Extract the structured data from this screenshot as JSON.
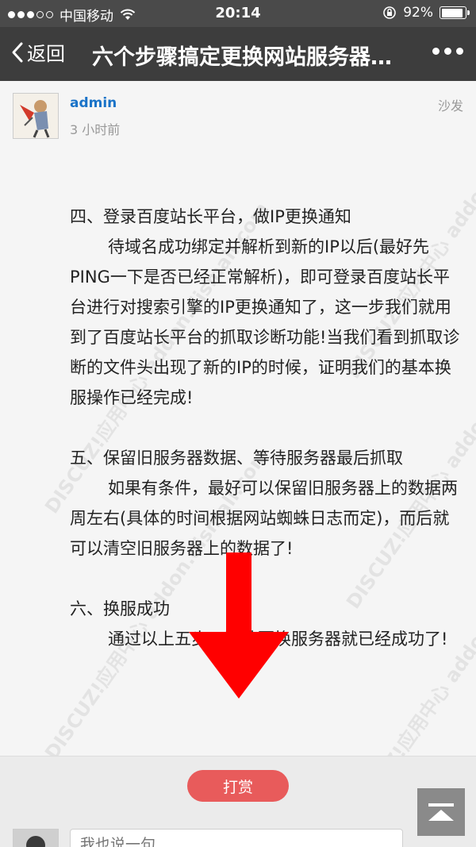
{
  "status_bar": {
    "carrier": "中国移动",
    "time": "20:14",
    "battery": "92%",
    "battery_level": 0.92
  },
  "nav": {
    "back_label": "返回",
    "title": "六个步骤搞定更换网站服务器…"
  },
  "post": {
    "author": "admin",
    "time": "3 小时前",
    "floor": "沙发",
    "watermark": "DISCUZ!应用中心 addon.dismall.com",
    "paragraphs": [
      {
        "text": "四、登录百度站长平台，做IP更换通知",
        "indent": false
      },
      {
        "text": "待域名成功绑定并解析到新的IP以后(最好先PING一下是否已经正常解析)，即可登录百度站长平台进行对搜索引擎的IP更换通知了，这一步我们就用到了百度站长平台的抓取诊断功能!当我们看到抓取诊断的文件头出现了新的IP的时候，证明我们的基本换服操作已经完成!",
        "indent": true
      },
      {
        "text": "",
        "gap": true
      },
      {
        "text": "五、保留旧服务器数据、等待服务器最后抓取",
        "indent": false
      },
      {
        "text": "如果有条件，最好可以保留旧服务器上的数据两周左右(具体的时间根据网站蜘蛛日志而定)，而后就可以清空旧服务器上的数据了!",
        "indent": true
      },
      {
        "text": "",
        "gap": true
      },
      {
        "text": "六、换服成功",
        "indent": false
      },
      {
        "text": "通过以上五步，网站更换服务器就已经成功了!",
        "indent": true
      }
    ]
  },
  "reward_button": "打赏",
  "comment": {
    "placeholder": "我也说一句"
  },
  "colors": {
    "nav_bg": "#3d3d3d",
    "status_bg": "#4a4a4a",
    "author": "#1a73c8",
    "reward": "#e85b5b",
    "arrow": "#ff0000"
  }
}
